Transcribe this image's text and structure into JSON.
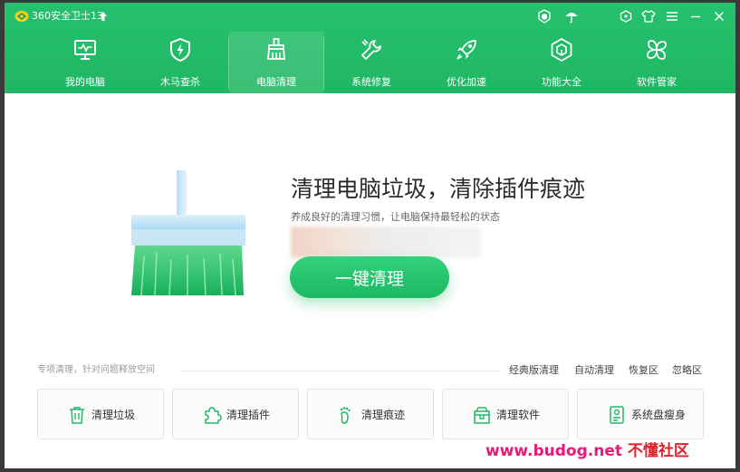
{
  "app": {
    "title": "360安全卫士13",
    "accent": "#22bb66"
  },
  "titlebar_icons": [
    "shield-badge-icon",
    "umbrella-icon",
    "skin-icon",
    "shirt-icon",
    "menu-icon",
    "minimize-icon",
    "close-icon"
  ],
  "nav": {
    "items": [
      {
        "label": "我的电脑",
        "icon": "monitor-icon"
      },
      {
        "label": "木马查杀",
        "icon": "shield-bolt-icon"
      },
      {
        "label": "电脑清理",
        "icon": "broom-icon",
        "active": true
      },
      {
        "label": "系统修复",
        "icon": "wrench-icon"
      },
      {
        "label": "优化加速",
        "icon": "rocket-icon"
      },
      {
        "label": "功能大全",
        "icon": "hexagon-icon"
      },
      {
        "label": "软件管家",
        "icon": "flower-icon"
      }
    ]
  },
  "main": {
    "headline": "清理电脑垃圾，清除插件痕迹",
    "subline": "养成良好的清理习惯，让电脑保持最轻松的状态",
    "clean_button": "一键清理"
  },
  "section": {
    "label": "专项清理，针对问题释放空间",
    "links": [
      "经典版清理",
      "自动清理",
      "恢复区",
      "忽略区"
    ]
  },
  "tools": [
    {
      "label": "清理垃圾",
      "icon": "trash-icon"
    },
    {
      "label": "清理插件",
      "icon": "puzzle-icon"
    },
    {
      "label": "清理痕迹",
      "icon": "footprint-icon"
    },
    {
      "label": "清理软件",
      "icon": "package-icon"
    },
    {
      "label": "系统盘瘦身",
      "icon": "disk-icon"
    }
  ],
  "watermark": {
    "site": "www.budog.net",
    "name": "不懂社区"
  }
}
